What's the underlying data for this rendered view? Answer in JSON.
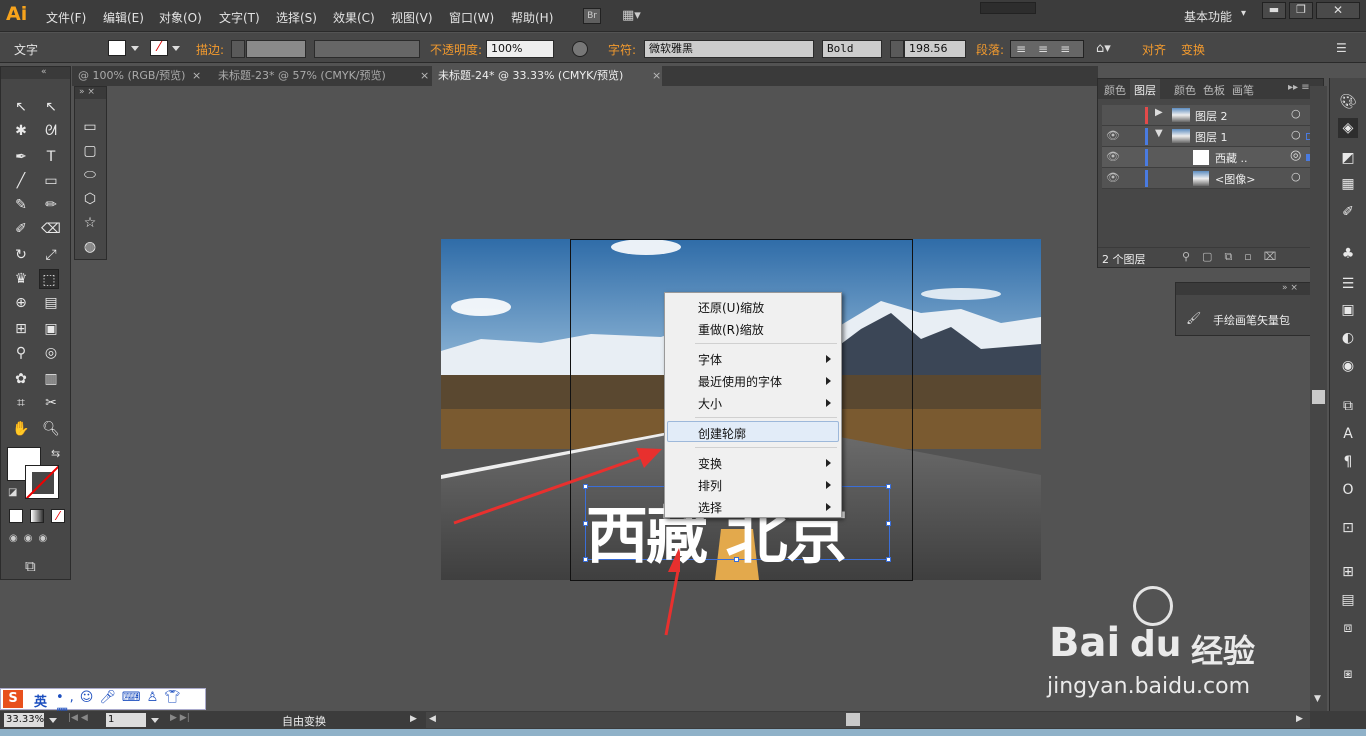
{
  "app": {
    "logo": "Ai",
    "workspace": "基本功能",
    "br_label": "Br"
  },
  "menu": [
    "文件(F)",
    "编辑(E)",
    "对象(O)",
    "文字(T)",
    "选择(S)",
    "效果(C)",
    "视图(V)",
    "窗口(W)",
    "帮助(H)"
  ],
  "control": {
    "tool_name": "文字",
    "stroke_label": "描边:",
    "opacity_label": "不透明度:",
    "opacity_value": "100%",
    "char_label": "字符:",
    "font_family": "微软雅黑",
    "font_style": "Bold",
    "font_size": "198.56",
    "para_label": "段落:",
    "align_label": "对齐",
    "transform_label": "变换"
  },
  "tabs": [
    {
      "title": "@ 100% (RGB/预览)"
    },
    {
      "title": "未标题-23* @ 57% (CMYK/预览)"
    },
    {
      "title": "未标题-24* @ 33.33% (CMYK/预览)"
    }
  ],
  "context_menu": {
    "undo": "还原(U)缩放",
    "redo": "重做(R)缩放",
    "font": "字体",
    "recent_fonts": "最近使用的字体",
    "size": "大小",
    "create_outlines": "创建轮廓",
    "transform": "变换",
    "arrange": "排列",
    "select": "选择"
  },
  "canvas": {
    "headline": "西藏 北京"
  },
  "layers": {
    "tabs": [
      "颜色",
      "图层",
      "颜色",
      "色板",
      "画笔"
    ],
    "rows": [
      {
        "name": "图层 2"
      },
      {
        "name": "图层 1"
      },
      {
        "name": "西藏 .."
      },
      {
        "name": "<图像>"
      }
    ],
    "footer": "2 个图层"
  },
  "brush_panel": {
    "item": "手绘画笔矢量包"
  },
  "status": {
    "zoom": "33.33%",
    "page": "1",
    "tool_status": "自由变换"
  },
  "ime": {
    "mode": "英"
  },
  "watermark": {
    "brand": "Bai",
    "brand2": "经验",
    "url": "jingyan.baidu.com"
  },
  "colors": {
    "accent": "#f29a2e",
    "bg": "#535353",
    "selection": "#3a6ed8"
  }
}
